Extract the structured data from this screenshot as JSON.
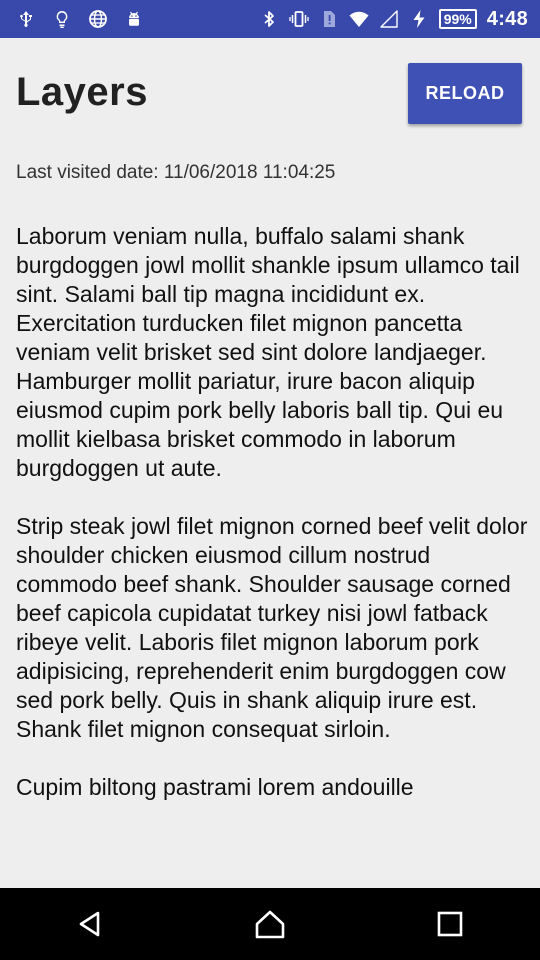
{
  "status_bar": {
    "left_icons": [
      "usb-icon",
      "lightbulb-icon",
      "globe-icon",
      "android-icon"
    ],
    "right_icons": [
      "bluetooth-icon",
      "vibrate-icon",
      "alert-sim-icon",
      "wifi-icon",
      "signal-icon",
      "charging-icon"
    ],
    "battery": "99%",
    "time": "4:48"
  },
  "header": {
    "title": "Layers",
    "reload_label": "RELOAD"
  },
  "visited": "Last visited date: 11/06/2018 11:04:25",
  "paragraphs": [
    "Laborum veniam nulla, buffalo salami shank burgdoggen jowl mollit shankle ipsum ullamco tail sint.  Salami ball tip magna incididunt ex.  Exercitation turducken filet mignon pancetta veniam velit brisket sed sint dolore landjaeger.  Hamburger mollit pariatur, irure bacon aliquip eiusmod cupim pork belly laboris ball tip.  Qui eu mollit kielbasa brisket commodo in laborum burgdoggen ut aute.",
    "Strip steak jowl filet mignon corned beef velit dolor shoulder chicken eiusmod cillum nostrud commodo beef shank.  Shoulder sausage corned beef capicola cupidatat turkey nisi jowl fatback ribeye velit.  Laboris filet mignon laborum pork adipisicing, reprehenderit enim burgdoggen cow sed pork belly.  Quis in shank aliquip irure est.  Shank filet mignon consequat sirloin.",
    "Cupim biltong pastrami lorem andouille"
  ],
  "nav_bar": [
    "back-icon",
    "home-icon",
    "recents-icon"
  ],
  "colors": {
    "status_bar": "#3949ab",
    "accent": "#3f51b5",
    "background": "#eeeeee"
  }
}
